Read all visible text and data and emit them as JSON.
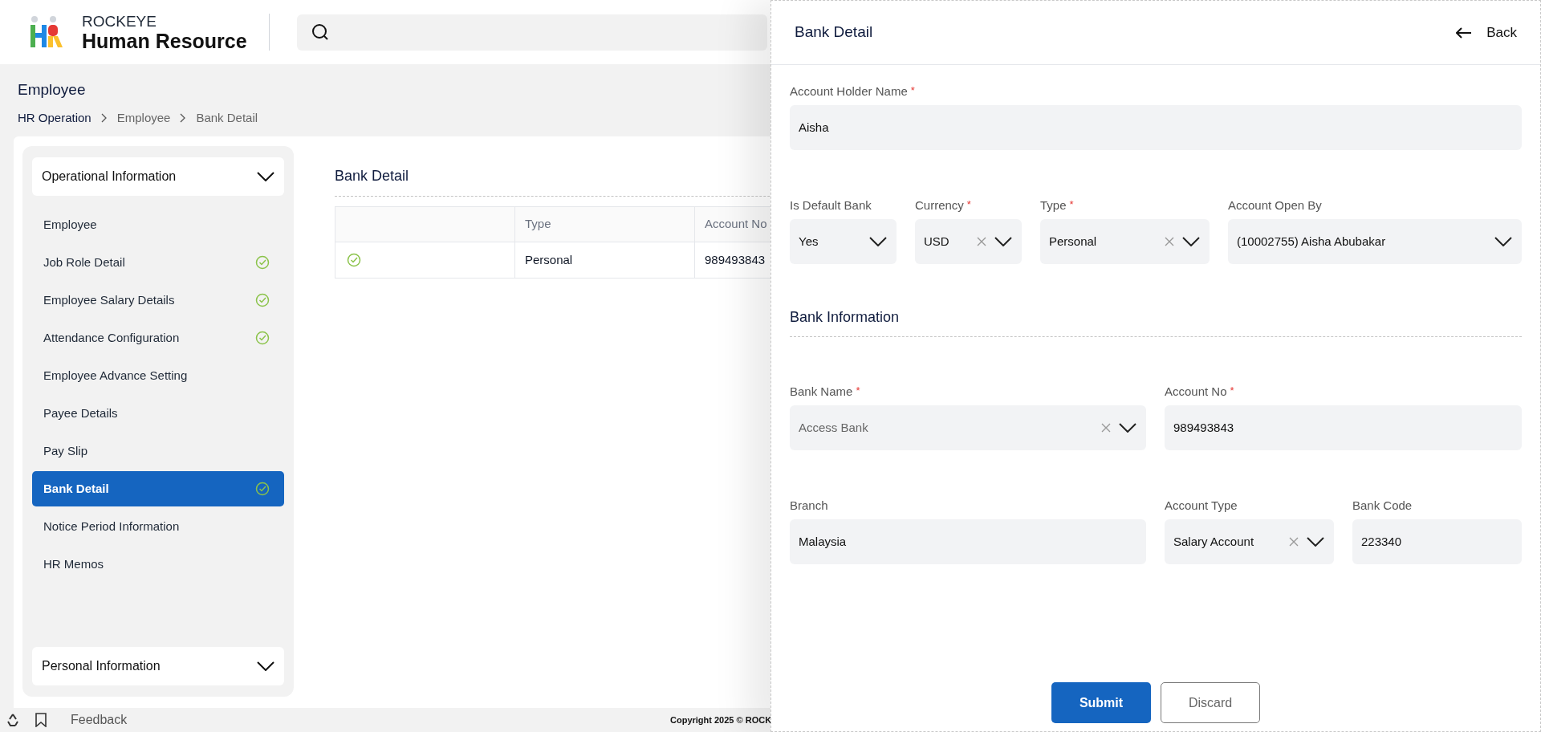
{
  "header": {
    "brand_top": "ROCKEYE",
    "brand_name": "Human Resource"
  },
  "page": {
    "title": "Employee",
    "breadcrumb": [
      "HR Operation",
      "Employee",
      "Bank Detail"
    ]
  },
  "sidebar": {
    "sections": [
      {
        "label": "Operational Information",
        "items": [
          {
            "label": "Employee",
            "completed": false,
            "selected": false
          },
          {
            "label": "Job Role Detail",
            "completed": true,
            "selected": false
          },
          {
            "label": "Employee Salary Details",
            "completed": true,
            "selected": false
          },
          {
            "label": "Attendance Configuration",
            "completed": true,
            "selected": false
          },
          {
            "label": "Employee Advance Setting",
            "completed": false,
            "selected": false
          },
          {
            "label": "Payee Details",
            "completed": false,
            "selected": false
          },
          {
            "label": "Pay Slip",
            "completed": false,
            "selected": false
          },
          {
            "label": "Bank Detail",
            "completed": true,
            "selected": true
          },
          {
            "label": "Notice Period Information",
            "completed": false,
            "selected": false
          },
          {
            "label": "HR Memos",
            "completed": false,
            "selected": false
          }
        ]
      },
      {
        "label": "Personal Information"
      }
    ]
  },
  "main": {
    "title": "Bank Detail",
    "table": {
      "columns": [
        "Type",
        "Account No"
      ],
      "rows": [
        {
          "is_default": true,
          "type": "Personal",
          "account_no": "989493843"
        }
      ]
    }
  },
  "footer": {
    "feedback": "Feedback",
    "copyright": "Copyright 2025 © ROCK"
  },
  "panel": {
    "title": "Bank Detail",
    "back": "Back",
    "rows": [
      {
        "fields": [
          {
            "label": "Account Holder Name",
            "required_mark": "*",
            "kind": "text",
            "value": "Aisha",
            "disabled": false
          }
        ]
      },
      {
        "fields": [
          {
            "label": "Is Default Bank",
            "kind": "select",
            "value": "Yes",
            "clearable": false,
            "disabled": false
          },
          {
            "label": "Currency",
            "required_mark": "*",
            "kind": "select",
            "value": "USD",
            "clearable": true,
            "disabled": false
          },
          {
            "label": "Type",
            "required_mark": "*",
            "kind": "select",
            "value": "Personal",
            "clearable": true,
            "disabled": false
          },
          {
            "label": "Account Open By",
            "kind": "select",
            "value": "(10002755) Aisha Abubakar",
            "clearable": false,
            "disabled": false
          }
        ]
      }
    ],
    "section_title": "Bank Information",
    "bank_rows": [
      {
        "fields": [
          {
            "label": "Bank Name",
            "required_mark": "*",
            "kind": "select",
            "value": "Access Bank",
            "clearable": true,
            "disabled": true
          },
          {
            "label": "Account No",
            "required_mark": "*",
            "kind": "text",
            "value": "989493843",
            "disabled": false
          }
        ]
      },
      {
        "fields": [
          {
            "label": "Branch",
            "kind": "text",
            "value": "Malaysia",
            "disabled": false
          },
          {
            "label": "Account Type",
            "kind": "select",
            "value": "Salary Account",
            "clearable": true,
            "disabled": false
          },
          {
            "label": "Bank Code",
            "kind": "text",
            "value": "223340",
            "disabled": false
          }
        ]
      }
    ],
    "buttons": [
      {
        "label": "Submit",
        "kind": "primary"
      },
      {
        "label": "Discard",
        "kind": "secondary"
      }
    ]
  }
}
